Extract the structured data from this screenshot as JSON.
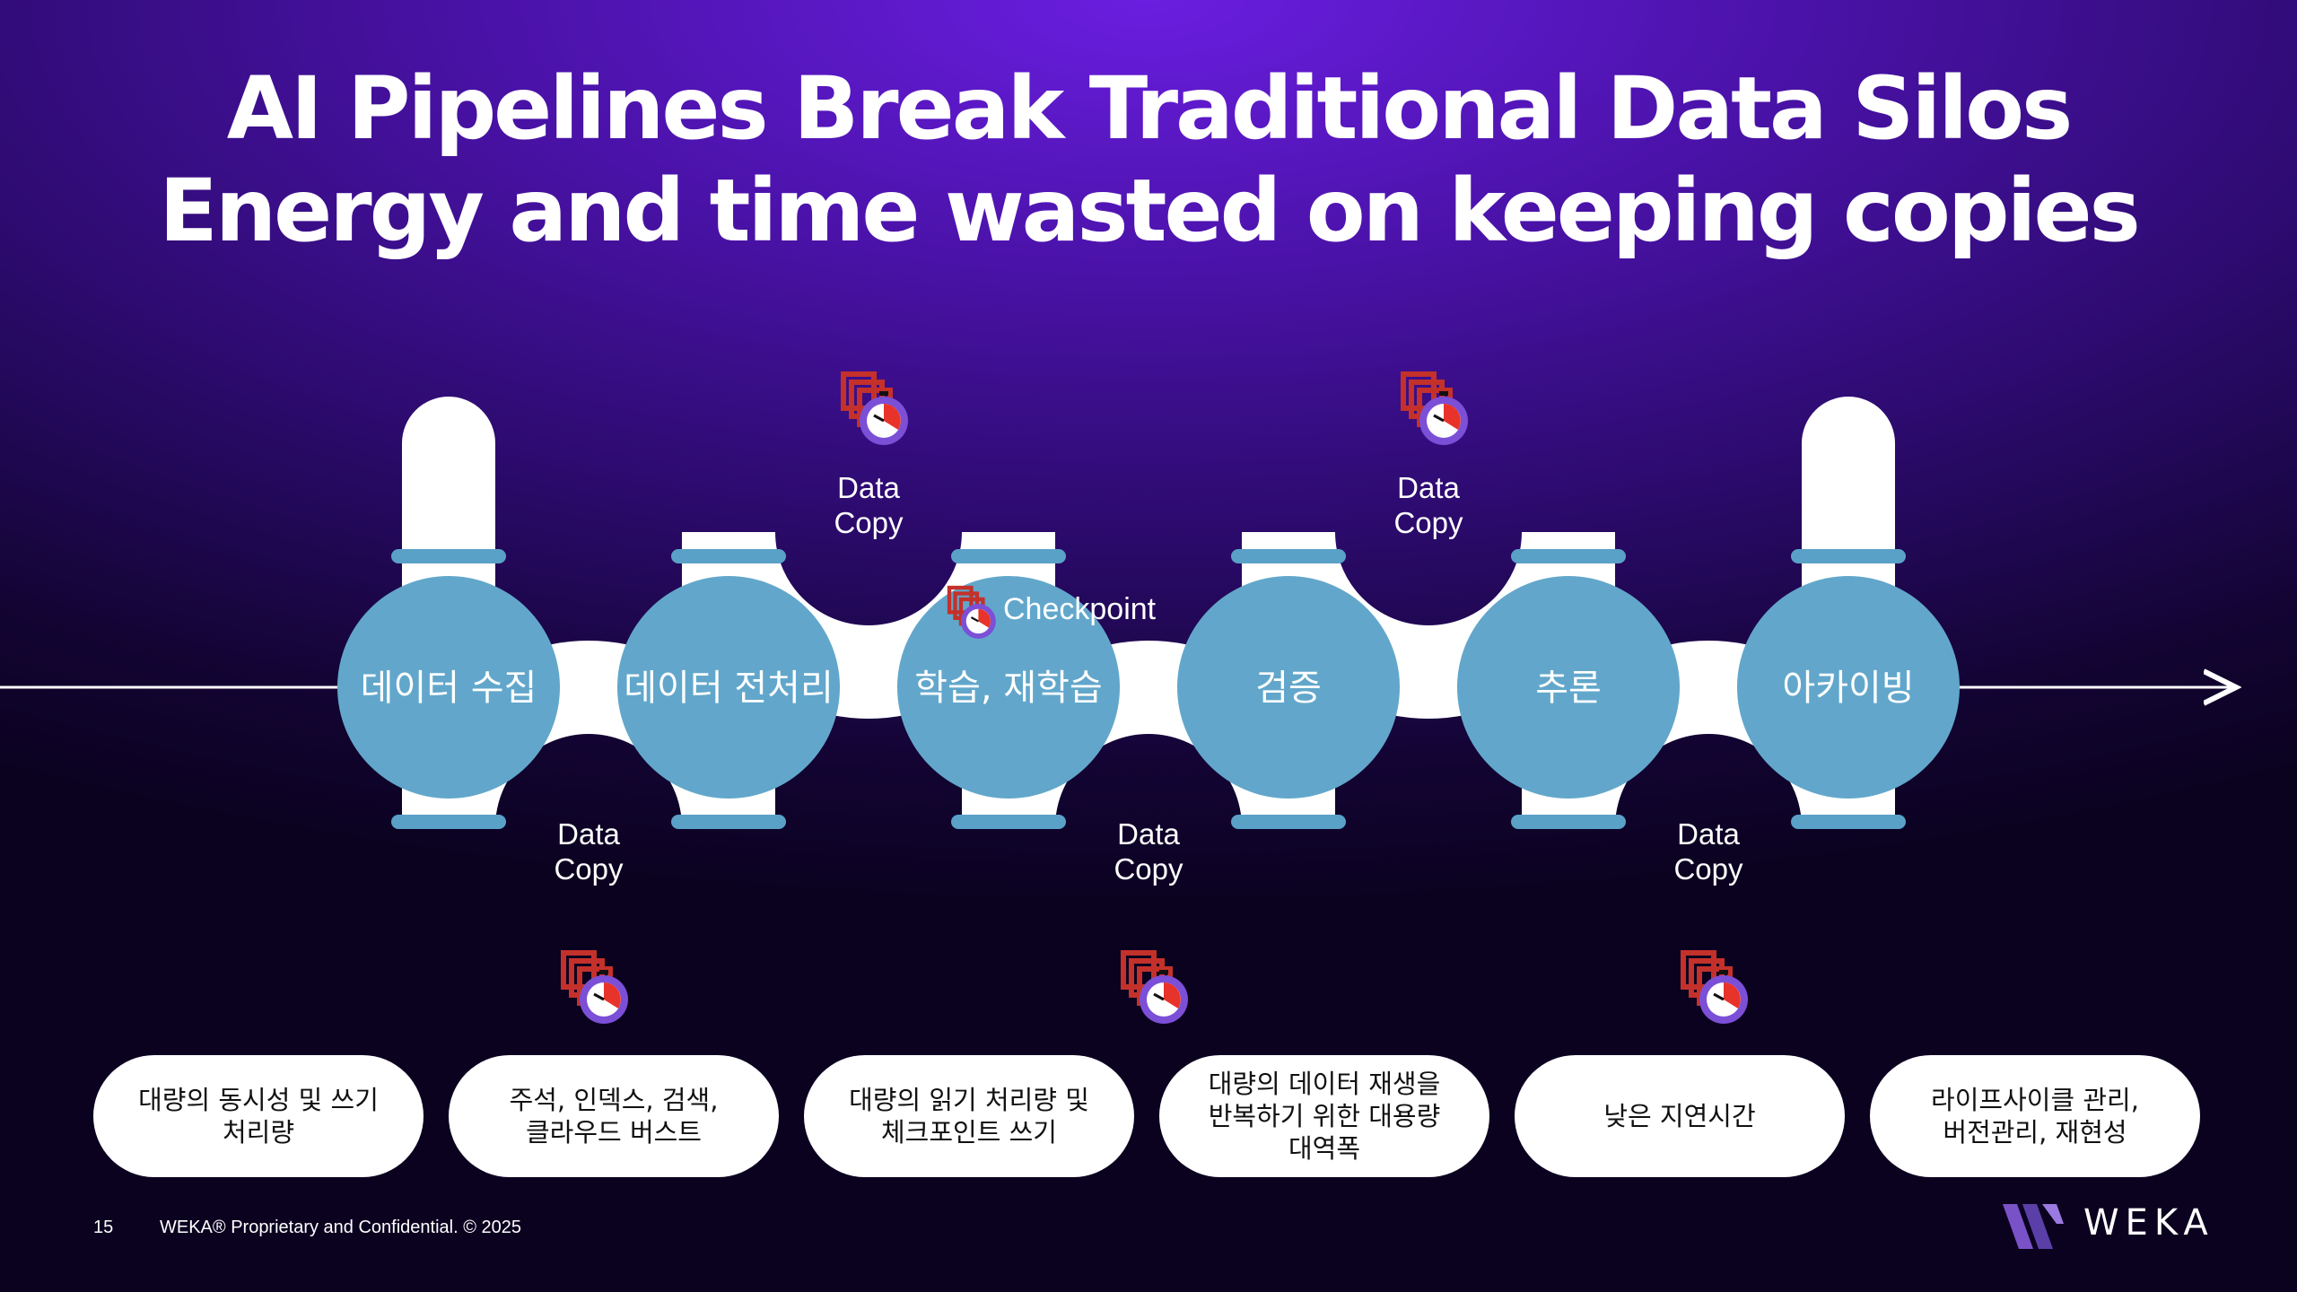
{
  "title": {
    "line1": "AI Pipelines Break Traditional Data Silos",
    "line2": "Energy and time wasted on keeping copies"
  },
  "stages": [
    {
      "label": "데이터 수집",
      "description": "대량의 동시성 및 쓰기\n처리량"
    },
    {
      "label": "데이터 전처리",
      "description": "주석, 인덱스, 검색,\n클라우드 버스트"
    },
    {
      "label": "학습, 재학습",
      "description": "대량의 읽기 처리량 및\n체크포인트 쓰기"
    },
    {
      "label": "검증",
      "description": "대량의 데이터 재생을\n반복하기 위한 대용량\n대역폭"
    },
    {
      "label": "추론",
      "description": "낮은 지연시간"
    },
    {
      "label": "아카이빙",
      "description": "라이프사이클 관리,\n버전관리, 재현성"
    }
  ],
  "data_copy_label": [
    "Data",
    "Copy"
  ],
  "checkpoint_label": "Checkpoint",
  "icons": {
    "copy": "stacked-copies-icon",
    "timer": "stopwatch-icon",
    "logo": "weka-logo-icon"
  },
  "colors": {
    "pipe": "#ffffff",
    "node": "#62a7cb",
    "band": "#5aa1c8",
    "copy_icon": "#c4312a",
    "timer_ring": "#7b4fd6"
  },
  "footer": {
    "page_number": "15",
    "text": "WEKA® Proprietary and Confidential. © 2025",
    "brand": "WEKA"
  }
}
